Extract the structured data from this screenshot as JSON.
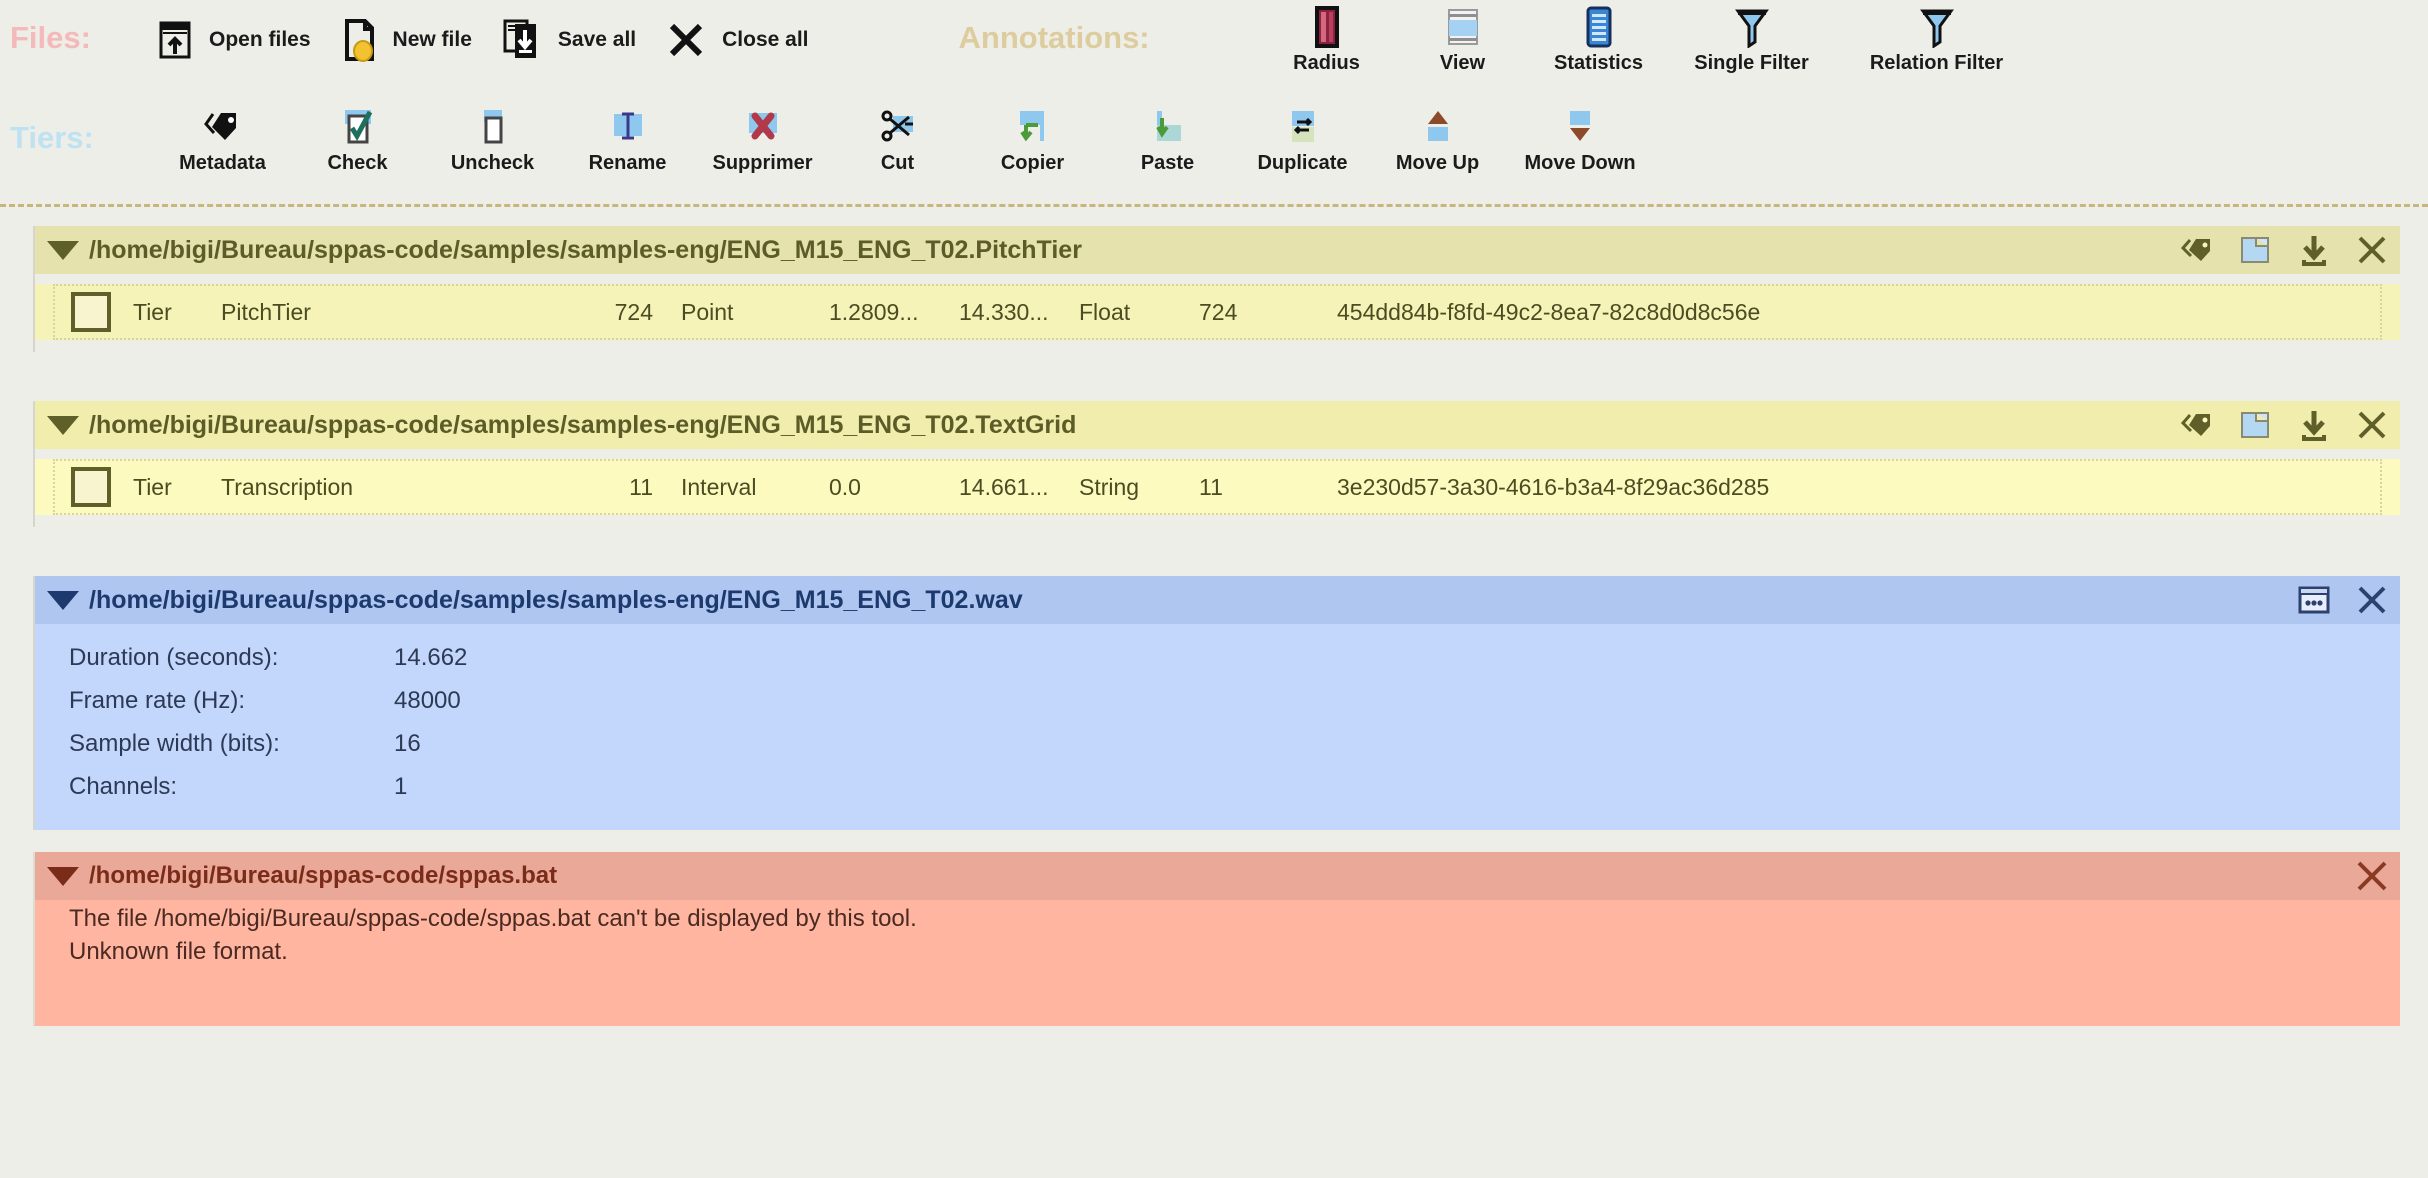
{
  "toolbar": {
    "files": {
      "label": "Files:",
      "label_color": "#f4b9b9",
      "buttons": [
        {
          "icon": "open-files-icon",
          "label": "Open files"
        },
        {
          "icon": "new-file-icon",
          "label": "New file"
        },
        {
          "icon": "save-all-icon",
          "label": "Save all"
        },
        {
          "icon": "close-all-icon",
          "label": "Close all"
        }
      ]
    },
    "annotations": {
      "label": "Annotations:",
      "label_color": "#ddcc9e",
      "buttons": [
        {
          "icon": "radius-icon",
          "label": "Radius"
        },
        {
          "icon": "view-icon",
          "label": "View"
        },
        {
          "icon": "statistics-icon",
          "label": "Statistics"
        },
        {
          "icon": "single-filter-icon",
          "label": "Single Filter"
        },
        {
          "icon": "relation-filter-icon",
          "label": "Relation Filter"
        }
      ]
    },
    "tiers": {
      "label": "Tiers:",
      "label_color": "#bfe2f2",
      "buttons": [
        {
          "icon": "metadata-icon",
          "label": "Metadata"
        },
        {
          "icon": "check-icon",
          "label": "Check"
        },
        {
          "icon": "uncheck-icon",
          "label": "Uncheck"
        },
        {
          "icon": "rename-icon",
          "label": "Rename"
        },
        {
          "icon": "delete-icon",
          "label": "Supprimer"
        },
        {
          "icon": "cut-icon",
          "label": "Cut"
        },
        {
          "icon": "copy-icon",
          "label": "Copier"
        },
        {
          "icon": "paste-icon",
          "label": "Paste"
        },
        {
          "icon": "duplicate-icon",
          "label": "Duplicate"
        },
        {
          "icon": "move-up-icon",
          "label": "Move Up"
        },
        {
          "icon": "move-down-icon",
          "label": "Move Down"
        }
      ]
    }
  },
  "panels": {
    "pitchtier": {
      "path": "/home/bigi/Bureau/sppas-code/samples/samples-eng/ENG_M15_ENG_T02.PitchTier",
      "tier": {
        "type": "Tier",
        "name": "PitchTier",
        "count": "724",
        "kind": "Point",
        "begin": "1.2809...",
        "end": "14.330...",
        "value_type": "Float",
        "points": "724",
        "id": "454dd84b-f8fd-49c2-8ea7-82c8d0d8c56e"
      }
    },
    "textgrid": {
      "path": "/home/bigi/Bureau/sppas-code/samples/samples-eng/ENG_M15_ENG_T02.TextGrid",
      "tier": {
        "type": "Tier",
        "name": "Transcription",
        "count": "11",
        "kind": "Interval",
        "begin": "0.0",
        "end": "14.661...",
        "value_type": "String",
        "points": "11",
        "id": "3e230d57-3a30-4616-b3a4-8f29ac36d285"
      }
    },
    "wav": {
      "path": "/home/bigi/Bureau/sppas-code/samples/samples-eng/ENG_M15_ENG_T02.wav",
      "properties": [
        {
          "key": "Duration (seconds):",
          "value": "14.662"
        },
        {
          "key": "Frame rate (Hz):",
          "value": "48000"
        },
        {
          "key": "Sample width (bits):",
          "value": "16"
        },
        {
          "key": "Channels:",
          "value": "1"
        }
      ]
    },
    "error": {
      "path": "/home/bigi/Bureau/sppas-code/sppas.bat",
      "message_line1": "The file /home/bigi/Bureau/sppas-code/sppas.bat can't be displayed by this tool.",
      "message_line2": "Unknown file format."
    }
  },
  "icons": {
    "metadata": "metadata-tag-icon",
    "copy": "copy-icon",
    "download": "download-icon",
    "close": "close-icon",
    "settings": "settings-window-icon"
  },
  "colors": {
    "background": "#eeeee8",
    "anno_header": "#e5e2ad",
    "anno_body": "#f6f3b8",
    "anno2_header": "#f1edad",
    "anno2_body": "#fdfac0",
    "audio_header": "#aec6f0",
    "audio_body": "#c3d6fb",
    "error_header": "#e9a898",
    "error_body": "#ffb5a0",
    "separator": "#c9b67f"
  }
}
